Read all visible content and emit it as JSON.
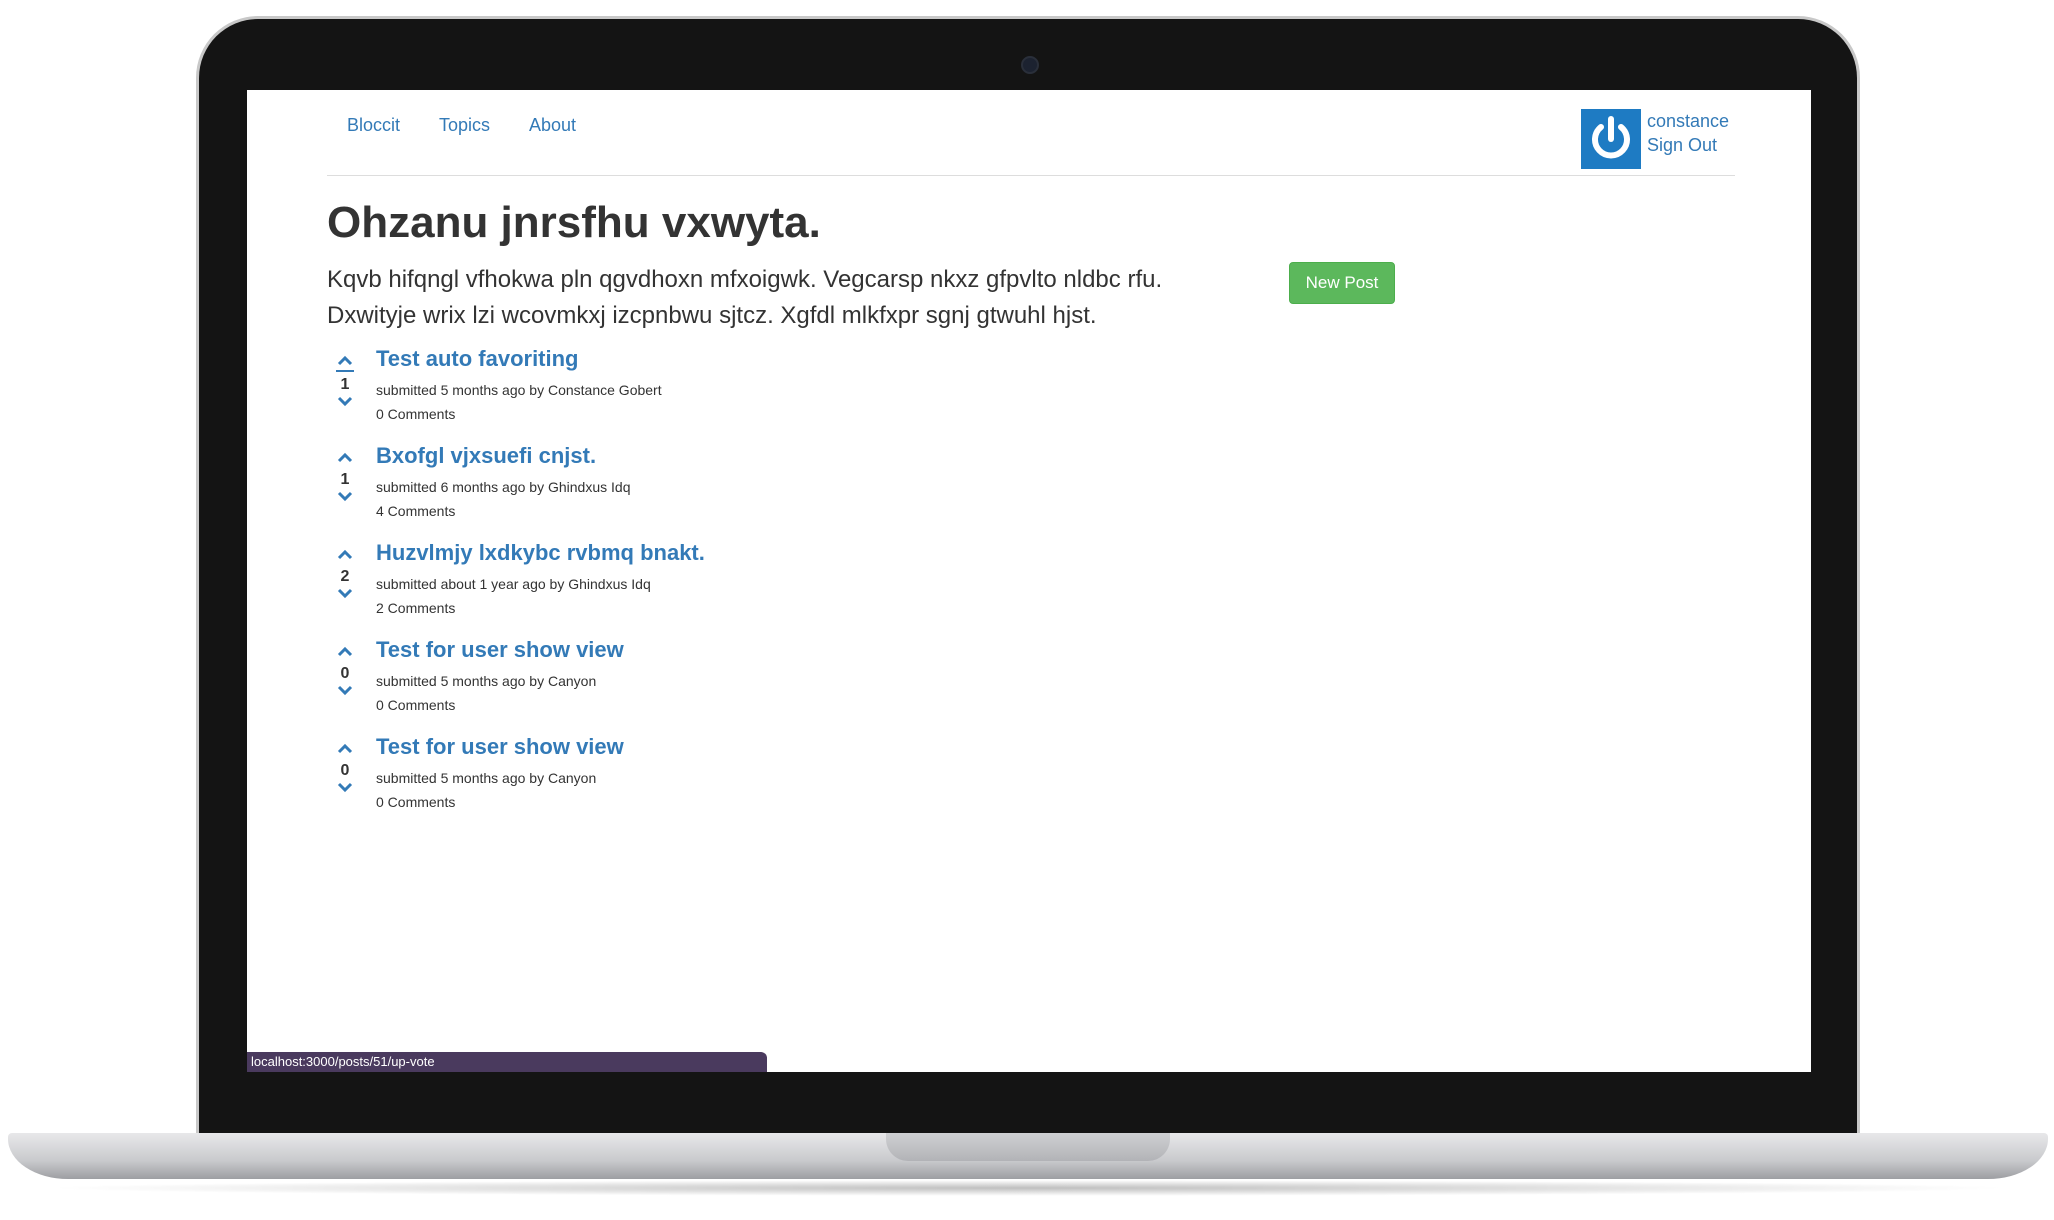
{
  "nav": {
    "brand": "Bloccit",
    "topics": "Topics",
    "about": "About"
  },
  "user": {
    "name": "constance",
    "sign_out": "Sign Out"
  },
  "page": {
    "title": "Ohzanu jnrsfhu vxwyta.",
    "lead": "Kqvb hifqngl vfhokwa pln qgvdhoxn mfxoigwk. Vegcarsp nkxz gfpvlto nldbc rfu. Dxwityje wrix lzi wcovmkxj izcpnbwu sjtcz. Xgfdl mlkfxpr sgnj gtwuhl hjst.",
    "new_post_label": "New Post"
  },
  "posts": [
    {
      "title": "Test auto favoriting",
      "votes": "1",
      "meta": "submitted 5 months ago by Constance Gobert",
      "comments": "0 Comments"
    },
    {
      "title": "Bxofgl vjxsuefi cnjst.",
      "votes": "1",
      "meta": "submitted 6 months ago by Ghindxus Idq",
      "comments": "4 Comments"
    },
    {
      "title": "Huzvlmjy lxdkybc rvbmq bnakt.",
      "votes": "2",
      "meta": "submitted about 1 year ago by Ghindxus Idq",
      "comments": "2 Comments"
    },
    {
      "title": "Test for user show view",
      "votes": "0",
      "meta": "submitted 5 months ago by Canyon",
      "comments": "0 Comments"
    },
    {
      "title": "Test for user show view",
      "votes": "0",
      "meta": "submitted 5 months ago by Canyon",
      "comments": "0 Comments"
    }
  ],
  "status_bar": {
    "url": "localhost:3000/posts/51/up-vote"
  },
  "icons": {
    "vote_up": "chevron-up-icon",
    "vote_down": "chevron-down-icon",
    "avatar": "power-icon"
  },
  "colors": {
    "link": "#337ab7",
    "button_success": "#5cb85c",
    "avatar_bg": "#1e7bc3",
    "status_bar_bg": "#4a3a5e"
  }
}
